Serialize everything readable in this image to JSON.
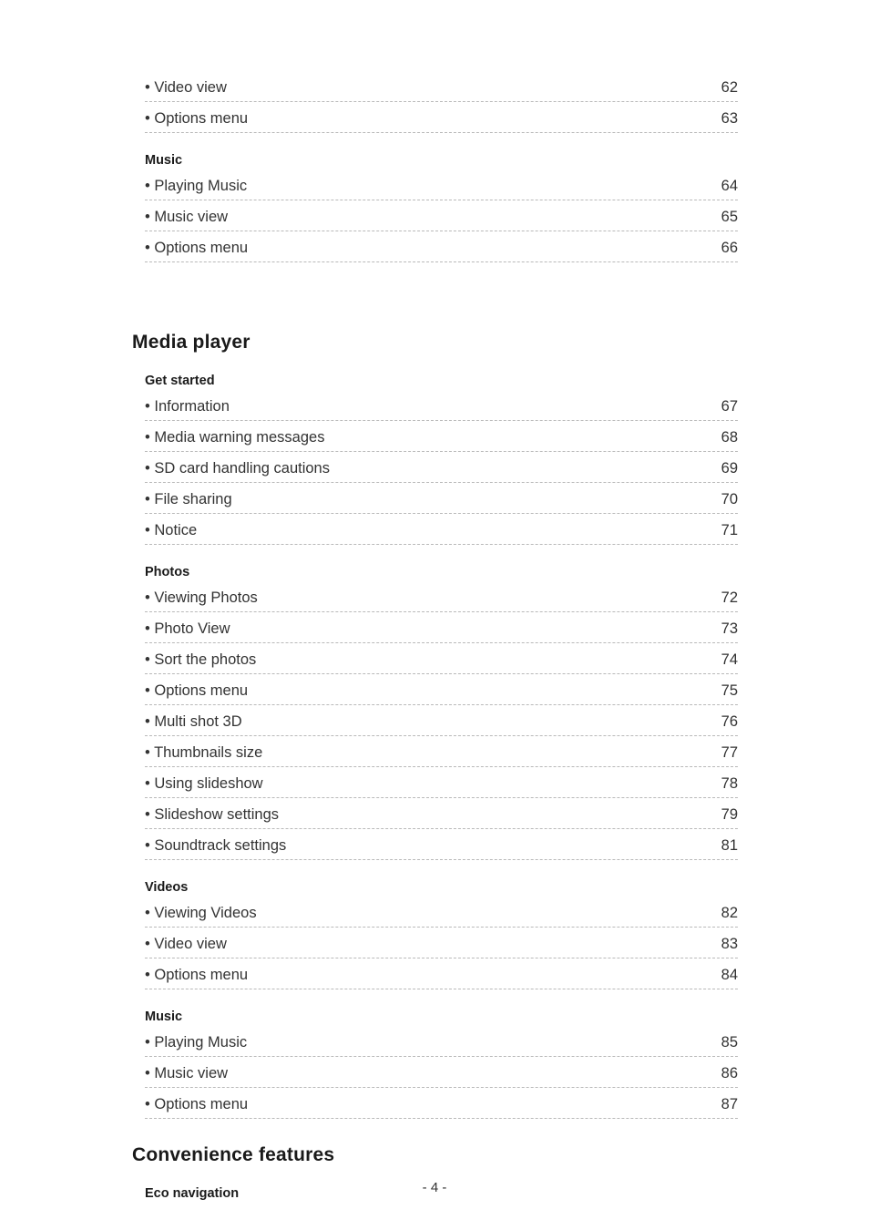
{
  "page": {
    "footer": "- 4 -",
    "bullet": "•"
  },
  "toc": {
    "blocks": [
      {
        "type": "entries",
        "entries": [
          {
            "label": "Video view",
            "page": "62"
          },
          {
            "label": "Options menu",
            "page": "63"
          }
        ]
      },
      {
        "type": "section",
        "title": "Music",
        "entries": [
          {
            "label": "Playing Music",
            "page": "64"
          },
          {
            "label": "Music view",
            "page": "65"
          },
          {
            "label": "Options menu",
            "page": "66"
          }
        ]
      },
      {
        "type": "chapter",
        "title": "Media player"
      },
      {
        "type": "section",
        "title": "Get started",
        "entries": [
          {
            "label": "Information",
            "page": "67"
          },
          {
            "label": "Media warning messages",
            "page": "68"
          },
          {
            "label": "SD card handling cautions",
            "page": "69"
          },
          {
            "label": "File sharing",
            "page": "70"
          },
          {
            "label": "Notice",
            "page": "71"
          }
        ]
      },
      {
        "type": "section",
        "title": "Photos",
        "entries": [
          {
            "label": "Viewing Photos",
            "page": "72"
          },
          {
            "label": "Photo View",
            "page": "73"
          },
          {
            "label": "Sort the photos",
            "page": "74"
          },
          {
            "label": "Options menu",
            "page": "75"
          },
          {
            "label": "Multi shot 3D",
            "page": "76"
          },
          {
            "label": "Thumbnails size",
            "page": "77"
          },
          {
            "label": "Using slideshow",
            "page": "78"
          },
          {
            "label": "Slideshow settings",
            "page": "79"
          },
          {
            "label": "Soundtrack settings",
            "page": "81"
          }
        ]
      },
      {
        "type": "section",
        "title": "Videos",
        "entries": [
          {
            "label": "Viewing Videos",
            "page": "82"
          },
          {
            "label": "Video view",
            "page": "83"
          },
          {
            "label": "Options menu",
            "page": "84"
          }
        ]
      },
      {
        "type": "section",
        "title": "Music",
        "entries": [
          {
            "label": "Playing Music",
            "page": "85"
          },
          {
            "label": "Music view",
            "page": "86"
          },
          {
            "label": "Options menu",
            "page": "87"
          }
        ]
      },
      {
        "type": "chapter",
        "title": "Convenience features"
      },
      {
        "type": "section",
        "title": "Eco navigation",
        "entries": []
      }
    ]
  }
}
